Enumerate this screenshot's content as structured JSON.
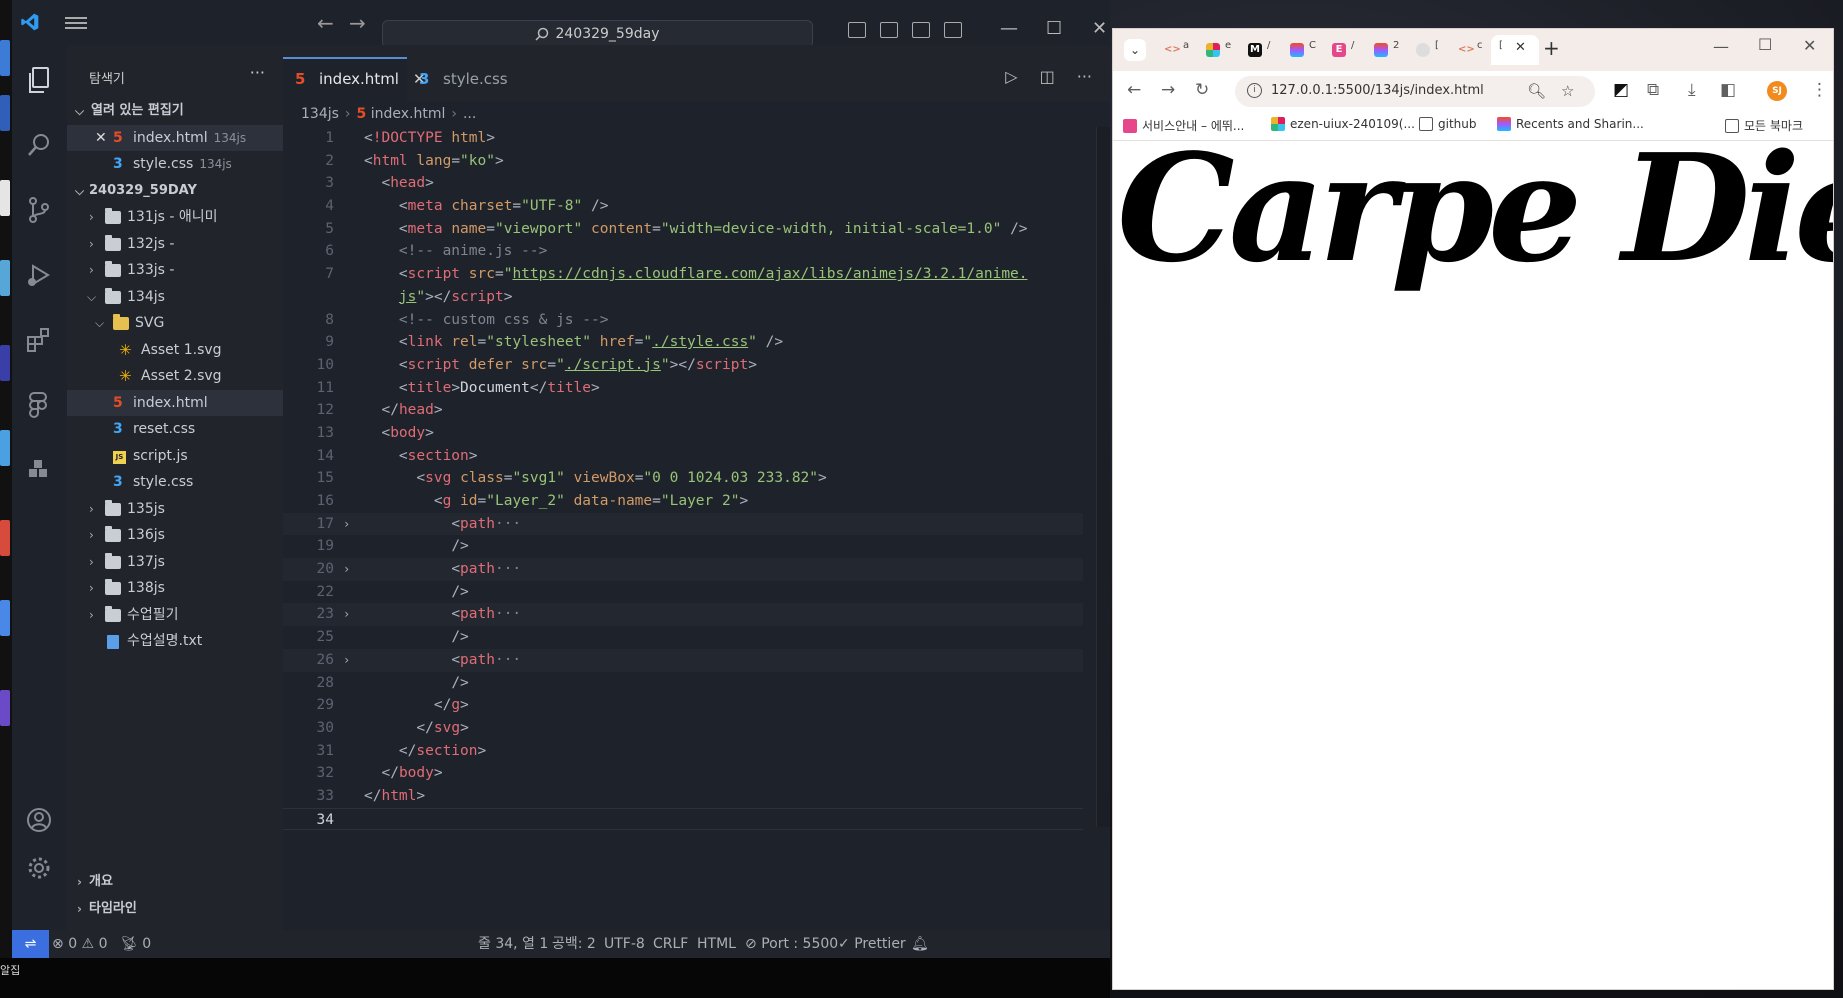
{
  "desktop": {
    "taskbar_text": "알집"
  },
  "vscode": {
    "search_text": "240329_59day",
    "explorer": {
      "title": "탐색기",
      "more": "···",
      "open_editors_header": "열려 있는 편집기",
      "open_editors": [
        {
          "name": "index.html",
          "folder": "134js"
        },
        {
          "name": "style.css",
          "folder": "134js"
        }
      ],
      "workspace_header": "240329_59DAY",
      "tree": [
        {
          "label": "131js - 애니미",
          "type": "folder"
        },
        {
          "label": "132js -",
          "type": "folder"
        },
        {
          "label": "133js -",
          "type": "folder"
        },
        {
          "label": "134js",
          "type": "folder-open"
        },
        {
          "label": "SVG",
          "type": "folder-open"
        },
        {
          "label": "Asset 1.svg",
          "type": "svg"
        },
        {
          "label": "Asset 2.svg",
          "type": "svg"
        },
        {
          "label": "index.html",
          "type": "html"
        },
        {
          "label": "reset.css",
          "type": "css"
        },
        {
          "label": "script.js",
          "type": "js"
        },
        {
          "label": "style.css",
          "type": "css"
        },
        {
          "label": "135js",
          "type": "folder"
        },
        {
          "label": "136js",
          "type": "folder"
        },
        {
          "label": "137js",
          "type": "folder"
        },
        {
          "label": "138js",
          "type": "folder"
        },
        {
          "label": "수업필기",
          "type": "folder"
        },
        {
          "label": "수업설명.txt",
          "type": "txt"
        }
      ],
      "outline": "개요",
      "timeline": "타임라인"
    },
    "tabs": [
      {
        "label": "index.html",
        "active": true
      },
      {
        "label": "style.css",
        "active": false
      }
    ],
    "breadcrumb": {
      "folder": "134js",
      "file": "index.html",
      "tail": "..."
    },
    "code_lines": [
      {
        "n": "1"
      },
      {
        "n": "2"
      },
      {
        "n": "3"
      },
      {
        "n": "4"
      },
      {
        "n": "5"
      },
      {
        "n": "6"
      },
      {
        "n": "7"
      },
      {
        "n": ""
      },
      {
        "n": "8"
      },
      {
        "n": "9"
      },
      {
        "n": "10"
      },
      {
        "n": "11"
      },
      {
        "n": "12"
      },
      {
        "n": "13"
      },
      {
        "n": "14"
      },
      {
        "n": "15"
      },
      {
        "n": "16"
      },
      {
        "n": "17"
      },
      {
        "n": "19"
      },
      {
        "n": "20"
      },
      {
        "n": "22"
      },
      {
        "n": "23"
      },
      {
        "n": "25"
      },
      {
        "n": "26"
      },
      {
        "n": "28"
      },
      {
        "n": "29"
      },
      {
        "n": "30"
      },
      {
        "n": "31"
      },
      {
        "n": "32"
      },
      {
        "n": "33"
      },
      {
        "n": "34"
      }
    ],
    "status": {
      "errors": "0",
      "warnings": "0",
      "ports": "0",
      "cursor": "줄 34, 열 1",
      "spaces": "공백: 2",
      "encoding": "UTF-8",
      "eol": "CRLF",
      "language": "HTML",
      "port": "Port : 5500",
      "prettier": "Prettier"
    }
  },
  "browser": {
    "url": "127.0.0.1:5500/134js/index.html",
    "tabs": [
      {
        "title": "a",
        "icon": "code-icon"
      },
      {
        "title": "e",
        "icon": "slack-icon"
      },
      {
        "title": "/",
        "icon": "m-icon"
      },
      {
        "title": "C",
        "icon": "figma-icon"
      },
      {
        "title": "/",
        "icon": "e-icon"
      },
      {
        "title": "2",
        "icon": "figma-icon"
      },
      {
        "title": "[",
        "icon": "globe-icon"
      },
      {
        "title": "c",
        "icon": "code-icon"
      },
      {
        "title": "[",
        "icon": "page-icon"
      }
    ],
    "profile": "SJ",
    "bookmarks": [
      {
        "label": "서비스안내 – 에뛰...",
        "icon": "e-icon"
      },
      {
        "label": "ezen-uiux-240109(...",
        "icon": "slack-icon"
      },
      {
        "label": "github",
        "icon": "folder-icon"
      },
      {
        "label": "Recents and Sharin...",
        "icon": "figma-icon"
      }
    ],
    "all_bookmarks": "모든 북마크",
    "page_text": "Carpe Diem",
    "colors": {
      "tab_strip": "#f3ece8",
      "profile": "#f28b1e"
    }
  }
}
